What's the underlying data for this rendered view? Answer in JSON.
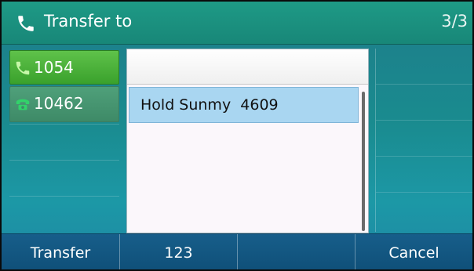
{
  "titlebar": {
    "title": "Transfer to",
    "page_indicator": "3/3",
    "icon": "phone-icon"
  },
  "line_keys": [
    {
      "label": "1054",
      "icon": "phone-active-icon",
      "state": "active"
    },
    {
      "label": "10462",
      "icon": "phone-hold-icon",
      "state": "held"
    }
  ],
  "popup": {
    "items": [
      {
        "label": "Hold Sunmy  4609",
        "selected": true
      }
    ]
  },
  "softkeys": [
    {
      "label": "Transfer"
    },
    {
      "label": "123"
    },
    {
      "label": ""
    },
    {
      "label": "Cancel"
    }
  ],
  "colors": {
    "titlebar": "#1e9a86",
    "active_line": "#4cb33a",
    "selected_item": "#a9d6f1",
    "softbar": "#155a85"
  }
}
